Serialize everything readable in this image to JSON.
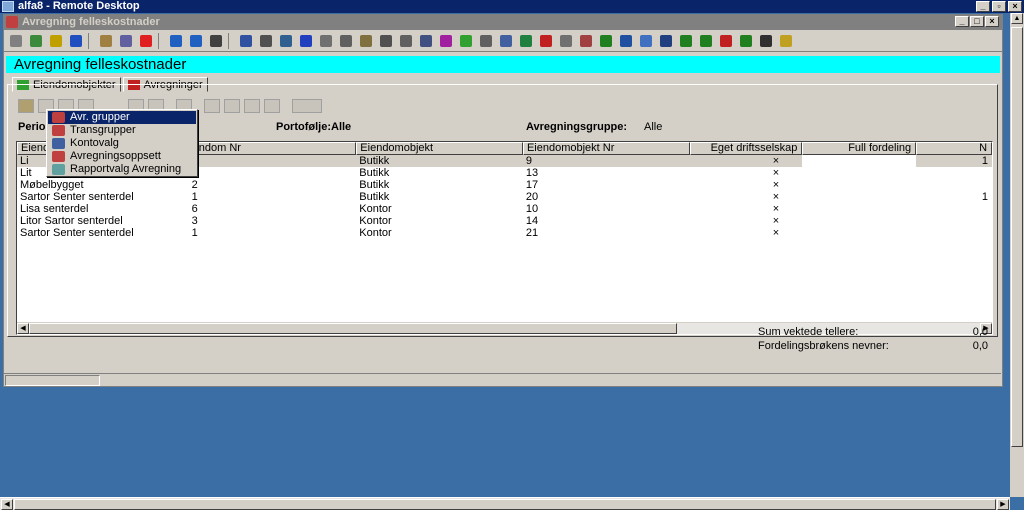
{
  "remote_desktop": {
    "title": "alfa8 - Remote Desktop",
    "min": "_",
    "restore": "▫",
    "close": "×"
  },
  "app": {
    "title": "Avregning felleskostnader",
    "min": "_",
    "restore": "□",
    "close": "×"
  },
  "heading": "Avregning felleskostnader",
  "tabs": [
    {
      "label": "Eiendomobjekter"
    },
    {
      "label": "Avregninger"
    }
  ],
  "filters": {
    "periode_label": "Perio",
    "portfolio": "Portofølje:Alle",
    "group_label": "Avregningsgruppe:",
    "group_value": "Alle"
  },
  "context_menu": {
    "items": [
      "Avr. grupper",
      "Transgrupper",
      "Kontovalg",
      "Avregningsoppsett",
      "Rapportvalg Avregning"
    ]
  },
  "grid": {
    "headers": [
      "Eiend",
      "endom Nr",
      "Eiendomobjekt",
      "Eiendomobjekt Nr",
      "Eget driftsselskap",
      "Full fordeling",
      "N"
    ],
    "rows": [
      [
        "Li",
        "",
        "Butikk",
        "9",
        "×",
        "",
        "1"
      ],
      [
        "Lit",
        "",
        "Butikk",
        "13",
        "×",
        "",
        ""
      ],
      [
        "Møbelbygget",
        "2",
        "Butikk",
        "17",
        "×",
        "",
        ""
      ],
      [
        "Sartor Senter senterdel",
        "1",
        "Butikk",
        "20",
        "×",
        "",
        "1"
      ],
      [
        "Lisa senterdel",
        "6",
        "Kontor",
        "10",
        "×",
        "",
        ""
      ],
      [
        "Litor Sartor senterdel",
        "3",
        "Kontor",
        "14",
        "×",
        "",
        ""
      ],
      [
        "Sartor Senter senterdel",
        "1",
        "Kontor",
        "21",
        "×",
        "",
        ""
      ]
    ]
  },
  "sums": [
    {
      "label": "Sum vektede tellere:",
      "value": "0,0"
    },
    {
      "label": "Fordelingsbrøkens nevner:",
      "value": "0,0"
    }
  ]
}
